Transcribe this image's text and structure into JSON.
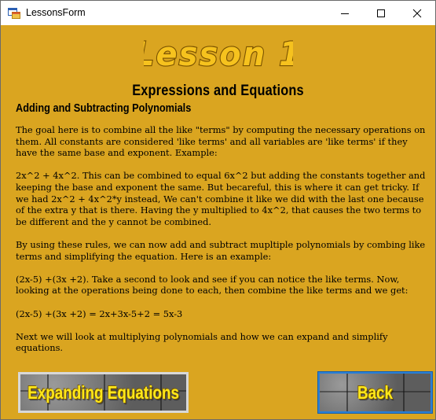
{
  "window": {
    "title": "LessonsForm",
    "icon": "winforms-app-icon",
    "controls": [
      "minimize-icon",
      "maximize-icon",
      "close-icon"
    ]
  },
  "header": {
    "logo_text": "Lesson 1",
    "title": "Expressions and Equations",
    "subtitle": "Adding and Subtracting Polynomials"
  },
  "content": {
    "paragraphs": [
      "The goal here is to combine all the like \"terms\" by computing the necessary operations on them. All constants are considered 'like terms' and all variables are 'like terms' if they have the same base and exponent. Example:",
      "2x^2 + 4x^2. This can be combined to equal 6x^2 but adding the constants together and keeping the base and exponent the same. But becareful, this is where it can get tricky. If we had 2x^2 + 4x^2*y instead, We can't combine it like we did with the last one because of the extra y that is there. Having the y multiplied to 4x^2, that causes the two terms to be different and the y cannot be combined.",
      "By using these rules, we can now add and subtract mupltiple polynomials by combing like terms and simplifying the equation. Here is an example:",
      "(2x-5) +(3x +2). Take a second to look and see if you can notice the like terms. Now, looking at the operations being done to each, then combine the like terms and we get:",
      "(2x-5) +(3x +2) = 2x+3x-5+2 = 5x-3",
      "Next we will look at multiplying polynomials and how we can expand and simplify equations."
    ]
  },
  "buttons": {
    "next_label": "Expanding Equations",
    "back_label": "Back"
  },
  "colors": {
    "background": "#DAA520",
    "button_text": "#FFE81A",
    "logo_fill": "#F6C21E"
  }
}
